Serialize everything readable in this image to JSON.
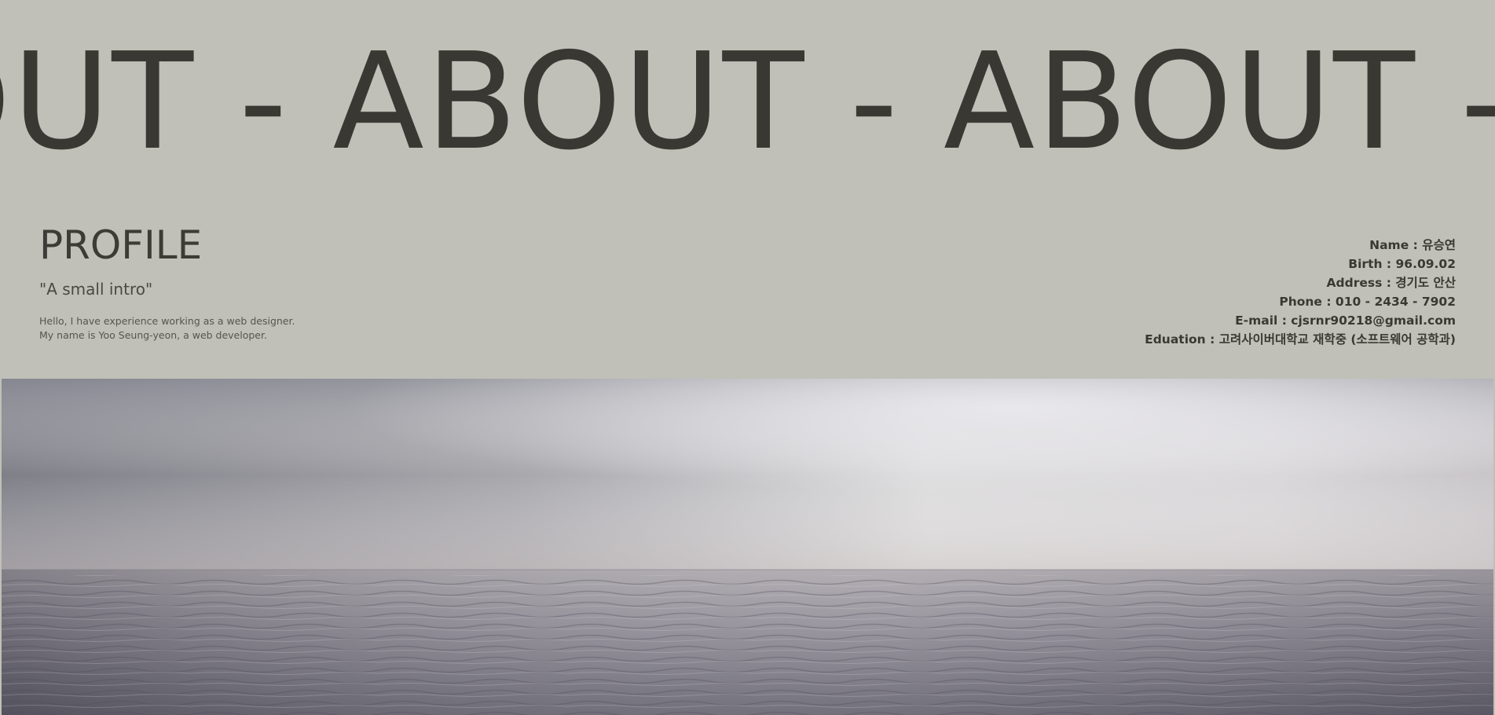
{
  "marquee": {
    "text": "OUT - ABOUT - ABOUT - ABOUT - A"
  },
  "profile": {
    "title": "PROFILE",
    "subtitle": "\"A small intro\"",
    "intro_lines": [
      "Hello, I have experience working as a web designer.",
      "My name is Yoo Seung-yeon, a web developer."
    ]
  },
  "info": {
    "name": "Name : 유승연",
    "birth": "Birth : 96.09.02",
    "address": "Address : 경기도 안산",
    "phone": "Phone : 010 - 2434 - 7902",
    "email": "E-mail : cjsrnr90218@gmail.com",
    "education": "Eduation : 고려사이버대학교 재학중 (소프트웨어 공학과)"
  },
  "colors": {
    "background": "#c0c0b8",
    "heading_text": "#3a3833",
    "sky_left": "#8a8a92",
    "sky_right": "#e0dfe0",
    "sea_dark": "#5c5a66"
  },
  "image": {
    "name": "sea-horizon-photo"
  }
}
